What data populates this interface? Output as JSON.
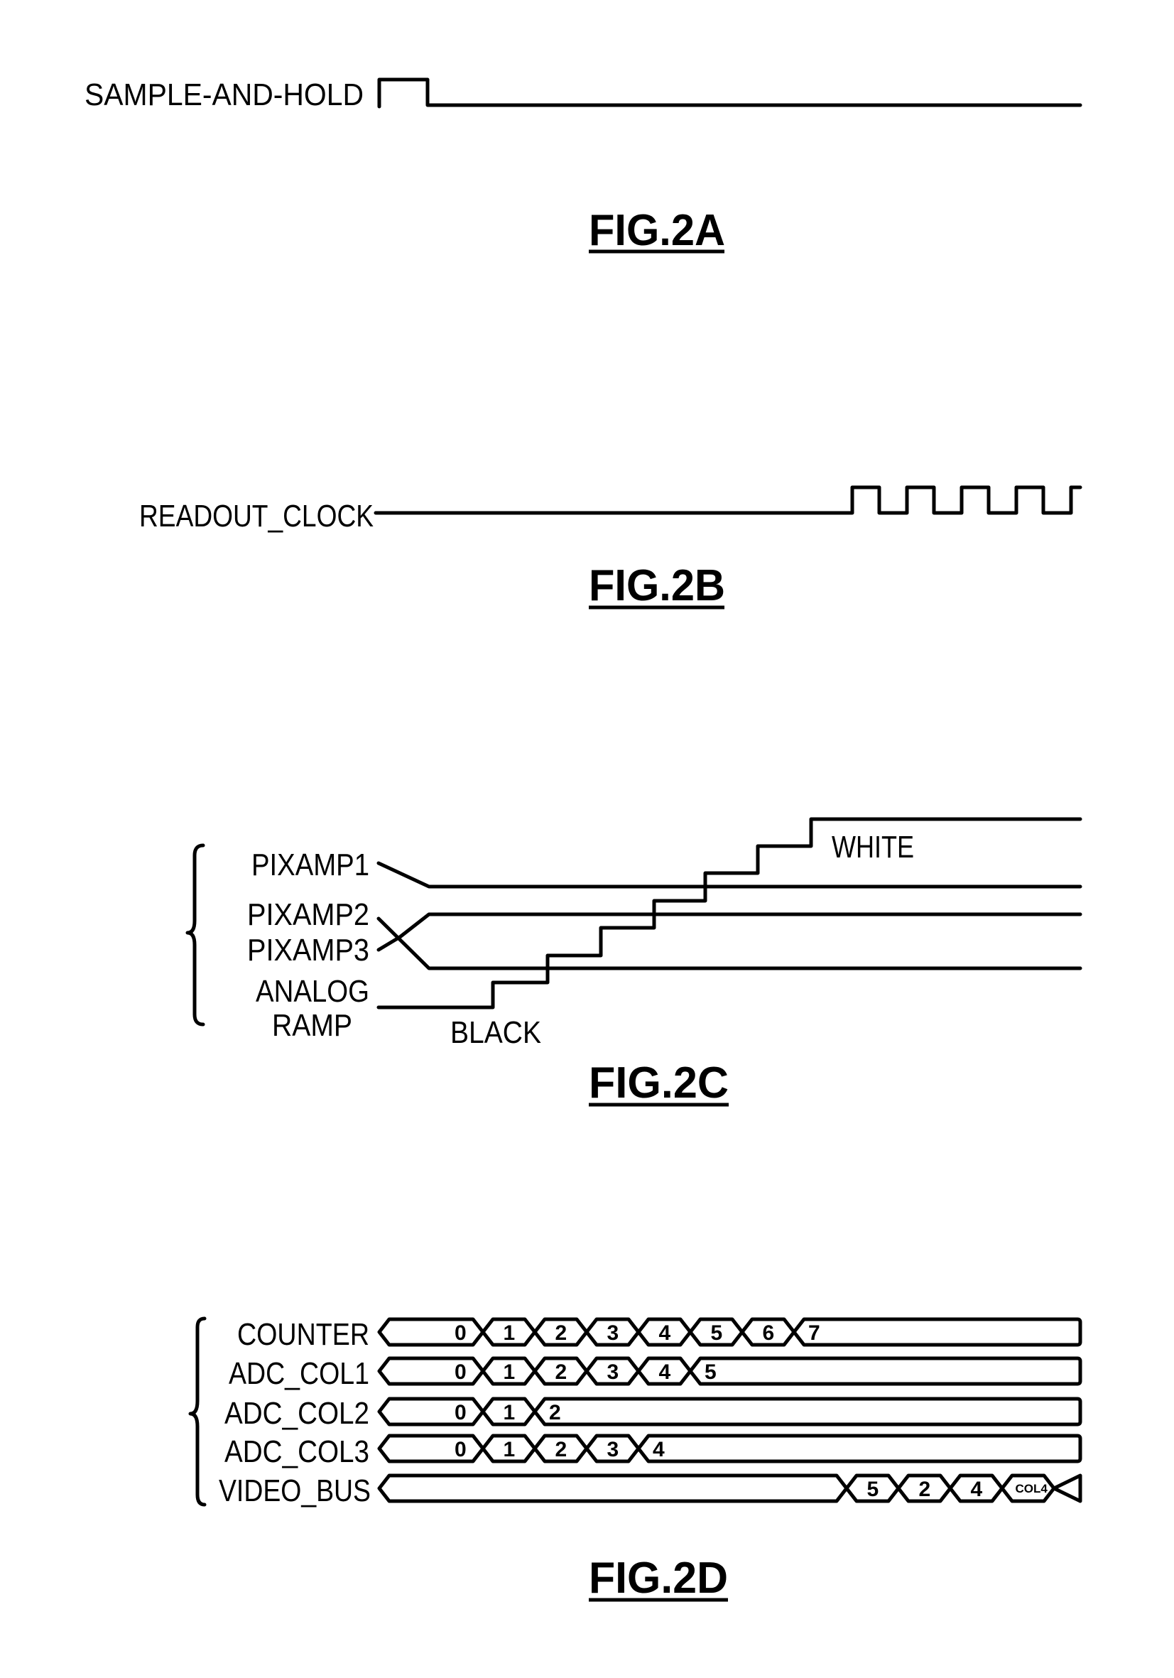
{
  "page": {
    "background": "#ffffff",
    "ink": "#000000"
  },
  "fig2a": {
    "caption": "FIG.2A",
    "signal_label": "SAMPLE-AND-HOLD",
    "waveform": "single high pulse at start, then low"
  },
  "fig2b": {
    "caption": "FIG.2B",
    "signal_label": "READOUT_CLOCK",
    "waveform": "low, then clock pulses",
    "clock_pulse_count": 5
  },
  "fig2c": {
    "caption": "FIG.2C",
    "signals": [
      {
        "label": "PIXAMP1",
        "level_rank": 3
      },
      {
        "label": "PIXAMP2",
        "level_rank": 2
      },
      {
        "label": "PIXAMP3",
        "level_rank": 1
      }
    ],
    "ramp_label_line1": "ANALOG",
    "ramp_label_line2": "RAMP",
    "ramp_steps": 7,
    "black_label": "BLACK",
    "white_label": "WHITE"
  },
  "fig2d": {
    "caption": "FIG.2D",
    "rows": [
      {
        "label": "COUNTER",
        "values": [
          "0",
          "1",
          "2",
          "3",
          "4",
          "5",
          "6",
          "7"
        ]
      },
      {
        "label": "ADC_COL1",
        "values": [
          "0",
          "1",
          "2",
          "3",
          "4",
          "5"
        ]
      },
      {
        "label": "ADC_COL2",
        "values": [
          "0",
          "1",
          "2"
        ]
      },
      {
        "label": "ADC_COL3",
        "values": [
          "0",
          "1",
          "2",
          "3",
          "4"
        ]
      },
      {
        "label": "VIDEO_BUS",
        "values": [
          "",
          "5",
          "2",
          "4",
          "COL4"
        ]
      }
    ]
  }
}
